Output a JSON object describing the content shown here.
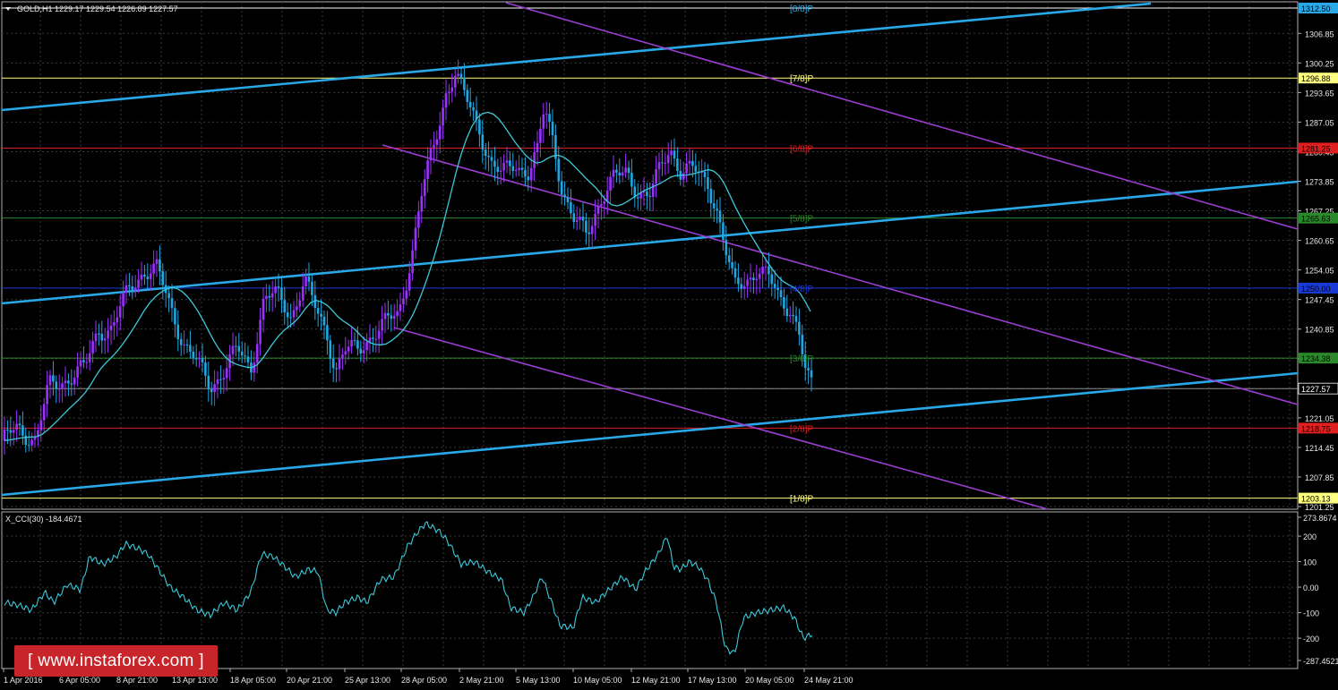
{
  "symbol_header": "GOLD,H1  1229.17 1229.54 1226.89 1227.57",
  "indicator_header": "X_CCI(30) -184.4671",
  "watermark": "[ www.instaforex.com ]",
  "colors": {
    "background": "#000000",
    "grid": "#3a3a3a",
    "bull_candle": "#9b30ff",
    "bear_candle": "#1ea7e1",
    "moving_average": "#3cc8d8",
    "channel_blue": "#29a8e8",
    "channel_purple": "#9a3ed0",
    "cci_line": "#3cc8d8",
    "watermark_bg": "#c8252b"
  },
  "price_axis": {
    "ticks": [
      "1312.50",
      "1306.85",
      "1300.25",
      "1293.65",
      "1287.05",
      "1280.45",
      "1273.85",
      "1267.25",
      "1260.65",
      "1254.05",
      "1247.45",
      "1240.85",
      "1234.25",
      "1227.57",
      "1221.05",
      "1214.45",
      "1207.85",
      "1201.25"
    ],
    "min": 1201.25,
    "max": 1312.5
  },
  "cci_axis": {
    "ticks": [
      "273.8674",
      "200",
      "100",
      "0.00",
      "-100",
      "-200",
      "-287.4521"
    ],
    "min": -287.4521,
    "max": 273.8674
  },
  "time_axis": [
    "1 Apr 2016",
    "6 Apr 05:00",
    "8 Apr 21:00",
    "13 Apr 13:00",
    "18 Apr 05:00",
    "20 Apr 21:00",
    "25 Apr 13:00",
    "28 Apr 05:00",
    "2 May 21:00",
    "5 May 13:00",
    "10 May 05:00",
    "12 May 21:00",
    "17 May 13:00",
    "20 May 05:00",
    "24 May 21:00"
  ],
  "murrey_levels": [
    {
      "label": "[8/8]P",
      "price": 1312.5,
      "price_tag": "1312.50",
      "line_color": "#ffffff",
      "tag_bg": "#29a8e8",
      "text_color": "#29a8e8"
    },
    {
      "label": "[7/8]P",
      "price": 1296.88,
      "price_tag": "1296.88",
      "line_color": "#ffff80",
      "tag_bg": "#ffff80",
      "text_color": "#ffff80"
    },
    {
      "label": "[6/8]P",
      "price": 1281.25,
      "price_tag": "1281.25",
      "line_color": "#e02020",
      "tag_bg": "#e02020",
      "text_color": "#e02020"
    },
    {
      "label": "[5/8]P",
      "price": 1265.63,
      "price_tag": "1265.63",
      "line_color": "#2a8a2a",
      "tag_bg": "#2a8a2a",
      "text_color": "#2a8a2a"
    },
    {
      "label": "[4/8]P",
      "price": 1250.0,
      "price_tag": "1250.00",
      "line_color": "#1a3ad8",
      "tag_bg": "#1a3ad8",
      "text_color": "#1a3ad8"
    },
    {
      "label": "[3/8]P",
      "price": 1234.38,
      "price_tag": "1234.38",
      "line_color": "#2a8a2a",
      "tag_bg": "#2a8a2a",
      "text_color": "#2a8a2a"
    },
    {
      "label": "[2/8]P",
      "price": 1218.75,
      "price_tag": "1218.75",
      "line_color": "#e02020",
      "tag_bg": "#e02020",
      "text_color": "#e02020"
    },
    {
      "label": "[1/8]P",
      "price": 1203.13,
      "price_tag": "1203.13",
      "line_color": "#ffff80",
      "tag_bg": "#ffff80",
      "text_color": "#ffff80"
    }
  ],
  "current_price": {
    "price": 1227.57,
    "price_tag": "1227.57"
  },
  "chart_data": {
    "type": "line",
    "title": "GOLD,H1",
    "series": [
      {
        "name": "GOLD,H1",
        "x": [
          "1 Apr 2016",
          "6 Apr 05:00",
          "8 Apr 21:00",
          "13 Apr 13:00",
          "18 Apr 05:00",
          "20 Apr 21:00",
          "25 Apr 13:00",
          "28 Apr 05:00",
          "2 May 21:00",
          "5 May 13:00",
          "10 May 05:00",
          "12 May 21:00",
          "17 May 13:00",
          "20 May 05:00",
          "24 May 21:00"
        ],
        "values": [
          1216,
          1232,
          1254,
          1228,
          1248,
          1252,
          1236,
          1262,
          1298,
          1275,
          1262,
          1280,
          1270,
          1252,
          1227.57
        ]
      },
      {
        "name": "X_CCI(30)",
        "x": [
          "1 Apr 2016",
          "6 Apr 05:00",
          "8 Apr 21:00",
          "13 Apr 13:00",
          "18 Apr 05:00",
          "20 Apr 21:00",
          "25 Apr 13:00",
          "28 Apr 05:00",
          "2 May 21:00",
          "5 May 13:00",
          "10 May 05:00",
          "12 May 21:00",
          "17 May 13:00",
          "20 May 05:00",
          "24 May 21:00"
        ],
        "values": [
          -60,
          40,
          170,
          -120,
          120,
          60,
          -100,
          230,
          60,
          -80,
          -150,
          60,
          -30,
          -80,
          -184.47
        ]
      }
    ],
    "ylim": [
      1201.25,
      1312.5
    ],
    "grid": true
  }
}
